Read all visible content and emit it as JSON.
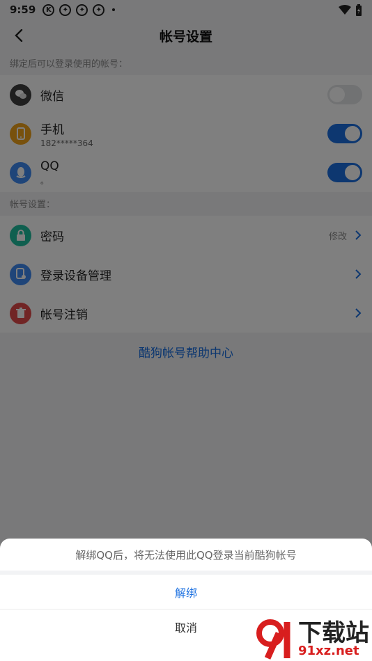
{
  "status_bar": {
    "time": "9:59",
    "icons": [
      "k-icon",
      "app-icon",
      "app-icon",
      "app-icon"
    ],
    "battery": "battery-icon",
    "wifi": "wifi-icon"
  },
  "header": {
    "title": "帐号设置"
  },
  "binding_section": {
    "label": "绑定后可以登录使用的帐号：",
    "items": [
      {
        "label": "微信",
        "sub": "",
        "icon": "wechat-icon",
        "icon_color": "#3e3e3e",
        "enabled": false
      },
      {
        "label": "手机",
        "sub": "182*****364",
        "icon": "phone-icon",
        "icon_color": "#f0a31a",
        "enabled": true
      },
      {
        "label": "QQ",
        "sub": "。",
        "icon": "qq-icon",
        "icon_color": "#3f8bf2",
        "enabled": true
      }
    ]
  },
  "account_section": {
    "label": "帐号设置：",
    "items": [
      {
        "label": "密码",
        "value": "修改",
        "icon": "lock-icon",
        "icon_color": "#1fbf9f"
      },
      {
        "label": "登录设备管理",
        "value": "",
        "icon": "device-icon",
        "icon_color": "#3f8bf2"
      },
      {
        "label": "帐号注销",
        "value": "",
        "icon": "trash-icon",
        "icon_color": "#e34a4a"
      }
    ]
  },
  "help_link": "酷狗帐号帮助中心",
  "dialog": {
    "message": "解绑QQ后，将无法使用此QQ登录当前酷狗帐号",
    "confirm": "解绑",
    "cancel": "取消"
  },
  "watermark": {
    "big": "下载站",
    "small": "91xz.net"
  },
  "colors": {
    "accent": "#1a6fe0",
    "overlay": "rgba(0,0,0,0.5)"
  }
}
